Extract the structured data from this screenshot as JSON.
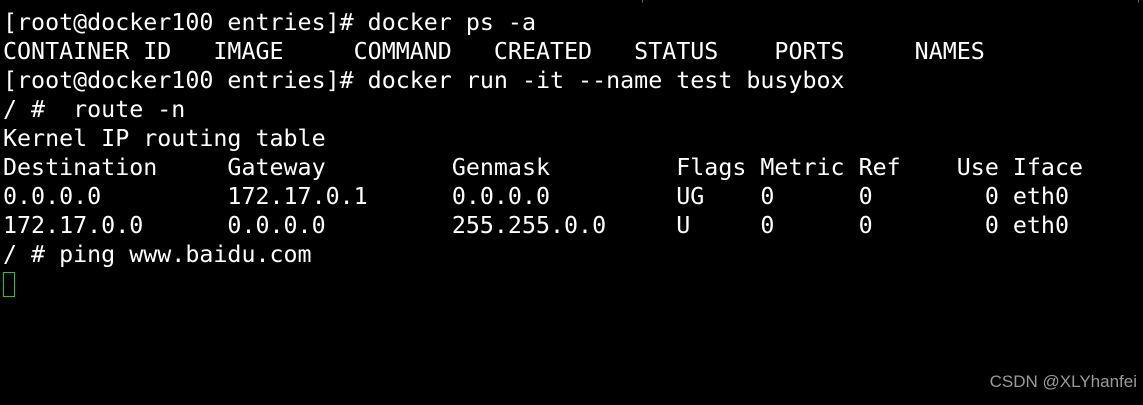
{
  "terminal": {
    "lines": [
      "[root@docker100 entries]# docker ps -a",
      "CONTAINER ID   IMAGE     COMMAND   CREATED   STATUS    PORTS     NAMES",
      "[root@docker100 entries]# docker run -it --name test busybox",
      "/ #  route -n",
      "Kernel IP routing table",
      "Destination     Gateway         Genmask         Flags Metric Ref    Use Iface",
      "0.0.0.0         172.17.0.1      0.0.0.0         UG    0      0        0 eth0",
      "172.17.0.0      0.0.0.0         255.255.0.0     U     0      0        0 eth0",
      "/ # ping www.baidu.com"
    ],
    "cursor_color": "#19cf19",
    "text_color": "#ffffff",
    "background_color": "#000000"
  },
  "watermark": {
    "text": "CSDN @XLYhanfei"
  }
}
